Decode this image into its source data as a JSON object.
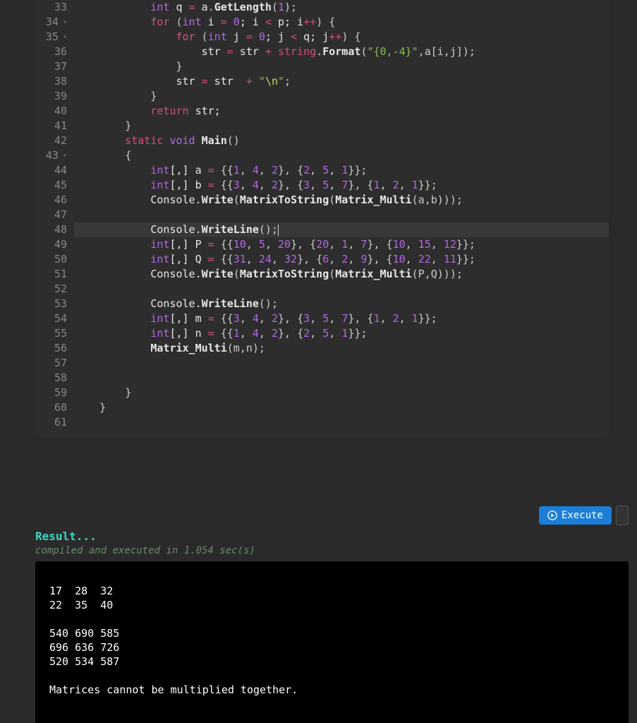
{
  "editor": {
    "first_line": 33,
    "highlighted_line": 48,
    "lines": [
      {
        "n": 33,
        "fold": false,
        "tokens": [
          [
            "            ",
            "pun"
          ],
          [
            "int",
            "type"
          ],
          [
            " q ",
            "id"
          ],
          [
            "=",
            "op"
          ],
          [
            " a",
            "id"
          ],
          [
            ".",
            "pun"
          ],
          [
            "GetLength",
            "fn"
          ],
          [
            "(",
            "pun"
          ],
          [
            "1",
            "num"
          ],
          [
            ");",
            "pun"
          ]
        ]
      },
      {
        "n": 34,
        "fold": true,
        "tokens": [
          [
            "            ",
            "pun"
          ],
          [
            "for",
            "kw"
          ],
          [
            " (",
            "pun"
          ],
          [
            "int",
            "type"
          ],
          [
            " i ",
            "id"
          ],
          [
            "=",
            "op"
          ],
          [
            " ",
            "pun"
          ],
          [
            "0",
            "num"
          ],
          [
            "; i ",
            "id"
          ],
          [
            "<",
            "op"
          ],
          [
            " p; i",
            "id"
          ],
          [
            "++",
            "op"
          ],
          [
            ") {",
            "pun"
          ]
        ]
      },
      {
        "n": 35,
        "fold": true,
        "tokens": [
          [
            "                ",
            "pun"
          ],
          [
            "for",
            "kw"
          ],
          [
            " (",
            "pun"
          ],
          [
            "int",
            "type"
          ],
          [
            " j ",
            "id"
          ],
          [
            "=",
            "op"
          ],
          [
            " ",
            "pun"
          ],
          [
            "0",
            "num"
          ],
          [
            "; j ",
            "id"
          ],
          [
            "<",
            "op"
          ],
          [
            " q; j",
            "id"
          ],
          [
            "++",
            "op"
          ],
          [
            ") {",
            "pun"
          ]
        ]
      },
      {
        "n": 36,
        "fold": false,
        "tokens": [
          [
            "                    str ",
            "id"
          ],
          [
            "=",
            "op"
          ],
          [
            " str ",
            "id"
          ],
          [
            "+",
            "op"
          ],
          [
            " ",
            "pun"
          ],
          [
            "string",
            "kw"
          ],
          [
            ".",
            "pun"
          ],
          [
            "Format",
            "fn"
          ],
          [
            "(",
            "pun"
          ],
          [
            "\"{0,-4}\"",
            "str"
          ],
          [
            ",a[i,j]);",
            "pun"
          ]
        ]
      },
      {
        "n": 37,
        "fold": false,
        "tokens": [
          [
            "                }",
            "pun"
          ]
        ]
      },
      {
        "n": 38,
        "fold": false,
        "tokens": [
          [
            "                str ",
            "id"
          ],
          [
            "=",
            "op"
          ],
          [
            " str  ",
            "id"
          ],
          [
            "+",
            "op"
          ],
          [
            " ",
            "pun"
          ],
          [
            "\"",
            "str"
          ],
          [
            "\\n",
            "esc"
          ],
          [
            "\"",
            "str"
          ],
          [
            ";",
            "pun"
          ]
        ]
      },
      {
        "n": 39,
        "fold": false,
        "tokens": [
          [
            "            }",
            "pun"
          ]
        ]
      },
      {
        "n": 40,
        "fold": false,
        "tokens": [
          [
            "            ",
            "pun"
          ],
          [
            "return",
            "kw"
          ],
          [
            " str;",
            "id"
          ]
        ]
      },
      {
        "n": 41,
        "fold": false,
        "tokens": [
          [
            "        }",
            "pun"
          ]
        ]
      },
      {
        "n": 42,
        "fold": false,
        "tokens": [
          [
            "        ",
            "pun"
          ],
          [
            "static",
            "kw"
          ],
          [
            " ",
            "pun"
          ],
          [
            "void",
            "type"
          ],
          [
            " ",
            "pun"
          ],
          [
            "Main",
            "fn"
          ],
          [
            "()",
            "pun"
          ]
        ]
      },
      {
        "n": 43,
        "fold": true,
        "tokens": [
          [
            "        {",
            "pun"
          ]
        ]
      },
      {
        "n": 44,
        "fold": false,
        "tokens": [
          [
            "            ",
            "pun"
          ],
          [
            "int",
            "type"
          ],
          [
            "[,] a ",
            "id"
          ],
          [
            "=",
            "op"
          ],
          [
            " {{",
            "pun"
          ],
          [
            "1",
            "num"
          ],
          [
            ", ",
            "pun"
          ],
          [
            "4",
            "num"
          ],
          [
            ", ",
            "pun"
          ],
          [
            "2",
            "num"
          ],
          [
            "}, {",
            "pun"
          ],
          [
            "2",
            "num"
          ],
          [
            ", ",
            "pun"
          ],
          [
            "5",
            "num"
          ],
          [
            ", ",
            "pun"
          ],
          [
            "1",
            "num"
          ],
          [
            "}};",
            "pun"
          ]
        ]
      },
      {
        "n": 45,
        "fold": false,
        "tokens": [
          [
            "            ",
            "pun"
          ],
          [
            "int",
            "type"
          ],
          [
            "[,] b ",
            "id"
          ],
          [
            "=",
            "op"
          ],
          [
            " {{",
            "pun"
          ],
          [
            "3",
            "num"
          ],
          [
            ", ",
            "pun"
          ],
          [
            "4",
            "num"
          ],
          [
            ", ",
            "pun"
          ],
          [
            "2",
            "num"
          ],
          [
            "}, {",
            "pun"
          ],
          [
            "3",
            "num"
          ],
          [
            ", ",
            "pun"
          ],
          [
            "5",
            "num"
          ],
          [
            ", ",
            "pun"
          ],
          [
            "7",
            "num"
          ],
          [
            "}, {",
            "pun"
          ],
          [
            "1",
            "num"
          ],
          [
            ", ",
            "pun"
          ],
          [
            "2",
            "num"
          ],
          [
            ", ",
            "pun"
          ],
          [
            "1",
            "num"
          ],
          [
            "}};",
            "pun"
          ]
        ]
      },
      {
        "n": 46,
        "fold": false,
        "tokens": [
          [
            "            Console.",
            "id"
          ],
          [
            "Write",
            "fn"
          ],
          [
            "(",
            "pun"
          ],
          [
            "MatrixToString",
            "fn"
          ],
          [
            "(",
            "pun"
          ],
          [
            "Matrix_Multi",
            "fn"
          ],
          [
            "(a,b)));",
            "pun"
          ]
        ]
      },
      {
        "n": 47,
        "fold": false,
        "tokens": [
          [
            "",
            "pun"
          ]
        ]
      },
      {
        "n": 48,
        "fold": false,
        "tokens": [
          [
            "            Console.",
            "id"
          ],
          [
            "WriteLine",
            "fn"
          ],
          [
            "();",
            "pun"
          ]
        ],
        "cursor": true
      },
      {
        "n": 49,
        "fold": false,
        "tokens": [
          [
            "            ",
            "pun"
          ],
          [
            "int",
            "type"
          ],
          [
            "[,] P ",
            "id"
          ],
          [
            "=",
            "op"
          ],
          [
            " {{",
            "pun"
          ],
          [
            "10",
            "num"
          ],
          [
            ", ",
            "pun"
          ],
          [
            "5",
            "num"
          ],
          [
            ", ",
            "pun"
          ],
          [
            "20",
            "num"
          ],
          [
            "}, {",
            "pun"
          ],
          [
            "20",
            "num"
          ],
          [
            ", ",
            "pun"
          ],
          [
            "1",
            "num"
          ],
          [
            ", ",
            "pun"
          ],
          [
            "7",
            "num"
          ],
          [
            "}, {",
            "pun"
          ],
          [
            "10",
            "num"
          ],
          [
            ", ",
            "pun"
          ],
          [
            "15",
            "num"
          ],
          [
            ", ",
            "pun"
          ],
          [
            "12",
            "num"
          ],
          [
            "}};",
            "pun"
          ]
        ]
      },
      {
        "n": 50,
        "fold": false,
        "tokens": [
          [
            "            ",
            "pun"
          ],
          [
            "int",
            "type"
          ],
          [
            "[,] Q ",
            "id"
          ],
          [
            "=",
            "op"
          ],
          [
            " {{",
            "pun"
          ],
          [
            "31",
            "num"
          ],
          [
            ", ",
            "pun"
          ],
          [
            "24",
            "num"
          ],
          [
            ", ",
            "pun"
          ],
          [
            "32",
            "num"
          ],
          [
            "}, {",
            "pun"
          ],
          [
            "6",
            "num"
          ],
          [
            ", ",
            "pun"
          ],
          [
            "2",
            "num"
          ],
          [
            ", ",
            "pun"
          ],
          [
            "9",
            "num"
          ],
          [
            "}, {",
            "pun"
          ],
          [
            "10",
            "num"
          ],
          [
            ", ",
            "pun"
          ],
          [
            "22",
            "num"
          ],
          [
            ", ",
            "pun"
          ],
          [
            "11",
            "num"
          ],
          [
            "}};",
            "pun"
          ]
        ]
      },
      {
        "n": 51,
        "fold": false,
        "tokens": [
          [
            "            Console.",
            "id"
          ],
          [
            "Write",
            "fn"
          ],
          [
            "(",
            "pun"
          ],
          [
            "MatrixToString",
            "fn"
          ],
          [
            "(",
            "pun"
          ],
          [
            "Matrix_Multi",
            "fn"
          ],
          [
            "(P,Q)));",
            "pun"
          ]
        ]
      },
      {
        "n": 52,
        "fold": false,
        "tokens": [
          [
            "",
            "pun"
          ]
        ]
      },
      {
        "n": 53,
        "fold": false,
        "tokens": [
          [
            "            Console.",
            "id"
          ],
          [
            "WriteLine",
            "fn"
          ],
          [
            "();",
            "pun"
          ]
        ]
      },
      {
        "n": 54,
        "fold": false,
        "tokens": [
          [
            "            ",
            "pun"
          ],
          [
            "int",
            "type"
          ],
          [
            "[,] m ",
            "id"
          ],
          [
            "=",
            "op"
          ],
          [
            " {{",
            "pun"
          ],
          [
            "3",
            "num"
          ],
          [
            ", ",
            "pun"
          ],
          [
            "4",
            "num"
          ],
          [
            ", ",
            "pun"
          ],
          [
            "2",
            "num"
          ],
          [
            "}, {",
            "pun"
          ],
          [
            "3",
            "num"
          ],
          [
            ", ",
            "pun"
          ],
          [
            "5",
            "num"
          ],
          [
            ", ",
            "pun"
          ],
          [
            "7",
            "num"
          ],
          [
            "}, {",
            "pun"
          ],
          [
            "1",
            "num"
          ],
          [
            ", ",
            "pun"
          ],
          [
            "2",
            "num"
          ],
          [
            ", ",
            "pun"
          ],
          [
            "1",
            "num"
          ],
          [
            "}};",
            "pun"
          ]
        ]
      },
      {
        "n": 55,
        "fold": false,
        "tokens": [
          [
            "            ",
            "pun"
          ],
          [
            "int",
            "type"
          ],
          [
            "[,] n ",
            "id"
          ],
          [
            "=",
            "op"
          ],
          [
            " {{",
            "pun"
          ],
          [
            "1",
            "num"
          ],
          [
            ", ",
            "pun"
          ],
          [
            "4",
            "num"
          ],
          [
            ", ",
            "pun"
          ],
          [
            "2",
            "num"
          ],
          [
            "}, {",
            "pun"
          ],
          [
            "2",
            "num"
          ],
          [
            ", ",
            "pun"
          ],
          [
            "5",
            "num"
          ],
          [
            ", ",
            "pun"
          ],
          [
            "1",
            "num"
          ],
          [
            "}};",
            "pun"
          ]
        ]
      },
      {
        "n": 56,
        "fold": false,
        "tokens": [
          [
            "            ",
            "id"
          ],
          [
            "Matrix_Multi",
            "fn"
          ],
          [
            "(m,n);",
            "pun"
          ]
        ]
      },
      {
        "n": 57,
        "fold": false,
        "tokens": [
          [
            "",
            "pun"
          ]
        ]
      },
      {
        "n": 58,
        "fold": false,
        "tokens": [
          [
            "",
            "pun"
          ]
        ]
      },
      {
        "n": 59,
        "fold": false,
        "tokens": [
          [
            "        }",
            "pun"
          ]
        ]
      },
      {
        "n": 60,
        "fold": false,
        "tokens": [
          [
            "    }",
            "pun"
          ]
        ]
      },
      {
        "n": 61,
        "fold": false,
        "tokens": [
          [
            "",
            "pun"
          ]
        ]
      }
    ]
  },
  "execute_label": "Execute",
  "result": {
    "header": "Result...",
    "sub": "compiled and executed in 1.054 sec(s)",
    "output": "\n17  28  32\n22  35  40\n\n540 690 585\n696 636 726\n520 534 587\n\nMatrices cannot be multiplied together."
  }
}
